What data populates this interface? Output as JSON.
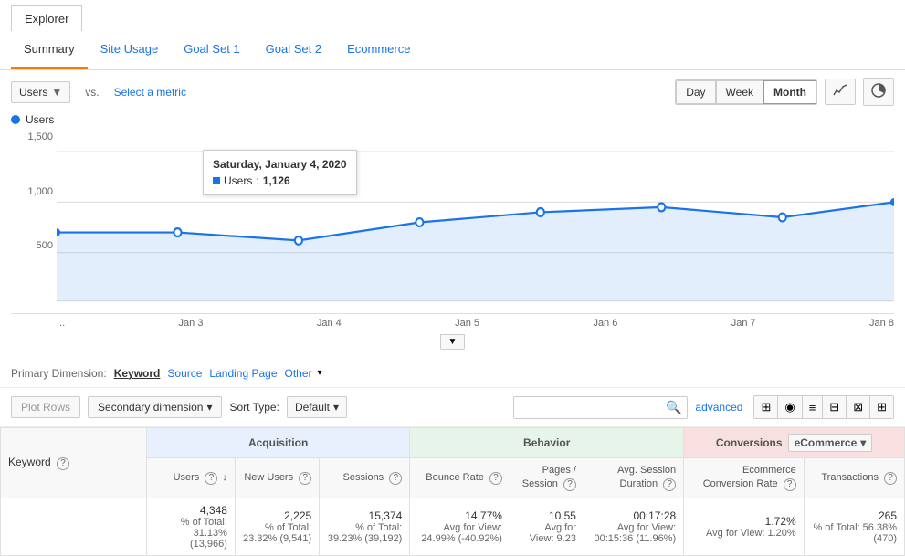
{
  "window": {
    "title": "Explorer"
  },
  "tabs": {
    "items": [
      {
        "label": "Summary",
        "active": true
      },
      {
        "label": "Site Usage",
        "active": false
      },
      {
        "label": "Goal Set 1",
        "active": false
      },
      {
        "label": "Goal Set 2",
        "active": false
      },
      {
        "label": "Ecommerce",
        "active": false
      }
    ]
  },
  "toolbar": {
    "metric_select": "Users",
    "vs_label": "vs.",
    "select_metric_label": "Select a metric",
    "day_btn": "Day",
    "week_btn": "Week",
    "month_btn": "Month"
  },
  "chart": {
    "legend_label": "Users",
    "y_axis": [
      "1,500",
      "1,000",
      "500"
    ],
    "x_axis": [
      "...",
      "Jan 3",
      "Jan 4",
      "Jan 5",
      "Jan 6",
      "Jan 7",
      "Jan 8"
    ],
    "tooltip": {
      "date": "Saturday, January 4, 2020",
      "metric": "Users",
      "value": "1,126"
    }
  },
  "primary_dimension": {
    "label": "Primary Dimension:",
    "active": "Keyword",
    "links": [
      "Source",
      "Landing Page",
      "Other"
    ]
  },
  "table_toolbar": {
    "plot_rows_btn": "Plot Rows",
    "secondary_dim_btn": "Secondary dimension",
    "sort_type_label": "Sort Type:",
    "sort_default": "Default",
    "search_placeholder": "",
    "advanced_link": "advanced"
  },
  "table": {
    "keyword_header": "Keyword",
    "acquisition_header": "Acquisition",
    "behavior_header": "Behavior",
    "conversions_header": "Conversions",
    "ecommerce_label": "eCommerce",
    "columns": {
      "users": "Users",
      "new_users": "New Users",
      "sessions": "Sessions",
      "bounce_rate": "Bounce Rate",
      "pages_session": "Pages / Session",
      "avg_session": "Avg. Session Duration",
      "ecommerce_rate": "Ecommerce Conversion Rate",
      "transactions": "Transactions"
    },
    "totals": {
      "users": "4,348",
      "users_pct": "% of Total: 31.13% (13,966)",
      "new_users": "2,225",
      "new_users_pct": "% of Total: 23.32% (9,541)",
      "sessions": "15,374",
      "sessions_pct": "% of Total: 39.23% (39,192)",
      "bounce_rate": "14.77%",
      "bounce_rate_avg": "Avg for View: 24.99% (-40.92%)",
      "pages_session": "10.55",
      "pages_session_avg": "Avg for View: 9.23",
      "avg_session": "00:17:28",
      "avg_session_avg": "Avg for View: 00:15:36 (11.96%)",
      "ecommerce_rate": "1.72%",
      "ecommerce_rate_avg": "Avg for View: 1.20%",
      "transactions": "265",
      "transactions_pct": "% of Total: 56.38% (470)"
    }
  }
}
